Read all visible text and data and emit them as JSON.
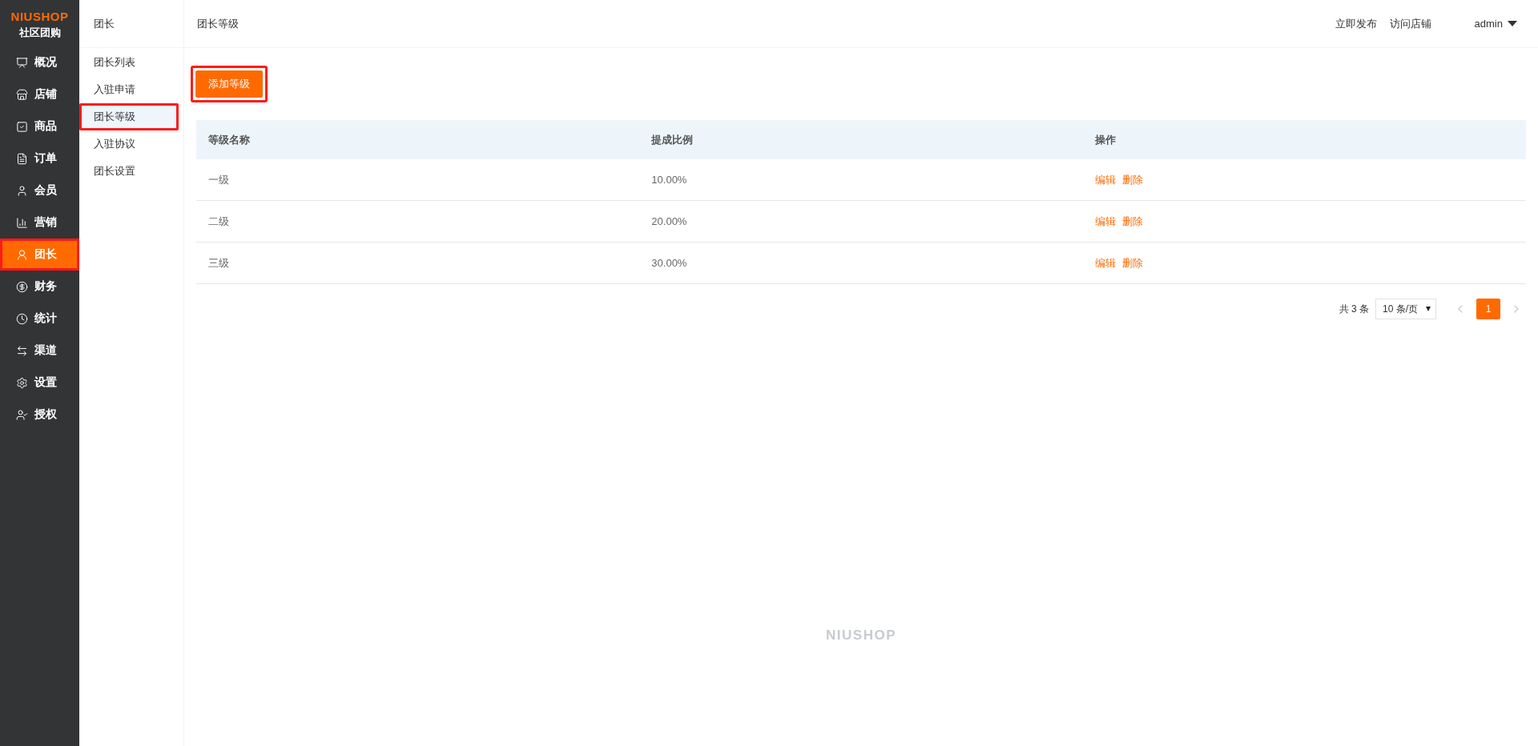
{
  "logo": {
    "brand": "NIUSHOP",
    "subtitle": "社区团购"
  },
  "main_nav": [
    {
      "label": "概况",
      "selected": false,
      "highlighted": false
    },
    {
      "label": "店铺",
      "selected": false,
      "highlighted": false
    },
    {
      "label": "商品",
      "selected": false,
      "highlighted": false
    },
    {
      "label": "订单",
      "selected": false,
      "highlighted": false
    },
    {
      "label": "会员",
      "selected": false,
      "highlighted": false
    },
    {
      "label": "营销",
      "selected": false,
      "highlighted": false
    },
    {
      "label": "团长",
      "selected": true,
      "highlighted": true
    },
    {
      "label": "财务",
      "selected": false,
      "highlighted": false
    },
    {
      "label": "统计",
      "selected": false,
      "highlighted": false
    },
    {
      "label": "渠道",
      "selected": false,
      "highlighted": false
    },
    {
      "label": "设置",
      "selected": false,
      "highlighted": false
    },
    {
      "label": "授权",
      "selected": false,
      "highlighted": false
    }
  ],
  "sub_nav": {
    "title": "团长",
    "items": [
      {
        "label": "团长列表",
        "selected": false,
        "highlighted": false
      },
      {
        "label": "入驻申请",
        "selected": false,
        "highlighted": false
      },
      {
        "label": "团长等级",
        "selected": true,
        "highlighted": true
      },
      {
        "label": "入驻协议",
        "selected": false,
        "highlighted": false
      },
      {
        "label": "团长设置",
        "selected": false,
        "highlighted": false
      }
    ]
  },
  "header": {
    "title": "团长等级",
    "links": [
      "立即发布",
      "访问店铺"
    ],
    "user": "admin"
  },
  "add_button": {
    "label": "添加等级",
    "highlighted": true
  },
  "table": {
    "columns": [
      "等级名称",
      "提成比例",
      "操作"
    ],
    "rows": [
      {
        "name": "一级",
        "ratio": "10.00%",
        "actions": [
          "编辑",
          "删除"
        ]
      },
      {
        "name": "二级",
        "ratio": "20.00%",
        "actions": [
          "编辑",
          "删除"
        ]
      },
      {
        "name": "三级",
        "ratio": "30.00%",
        "actions": [
          "编辑",
          "删除"
        ]
      }
    ]
  },
  "pagination": {
    "total": "共 3 条",
    "page_size": "10 条/页",
    "pages": [
      {
        "label": "1",
        "selected": true
      }
    ]
  },
  "footer": {
    "brand": "NIUSHOP"
  }
}
